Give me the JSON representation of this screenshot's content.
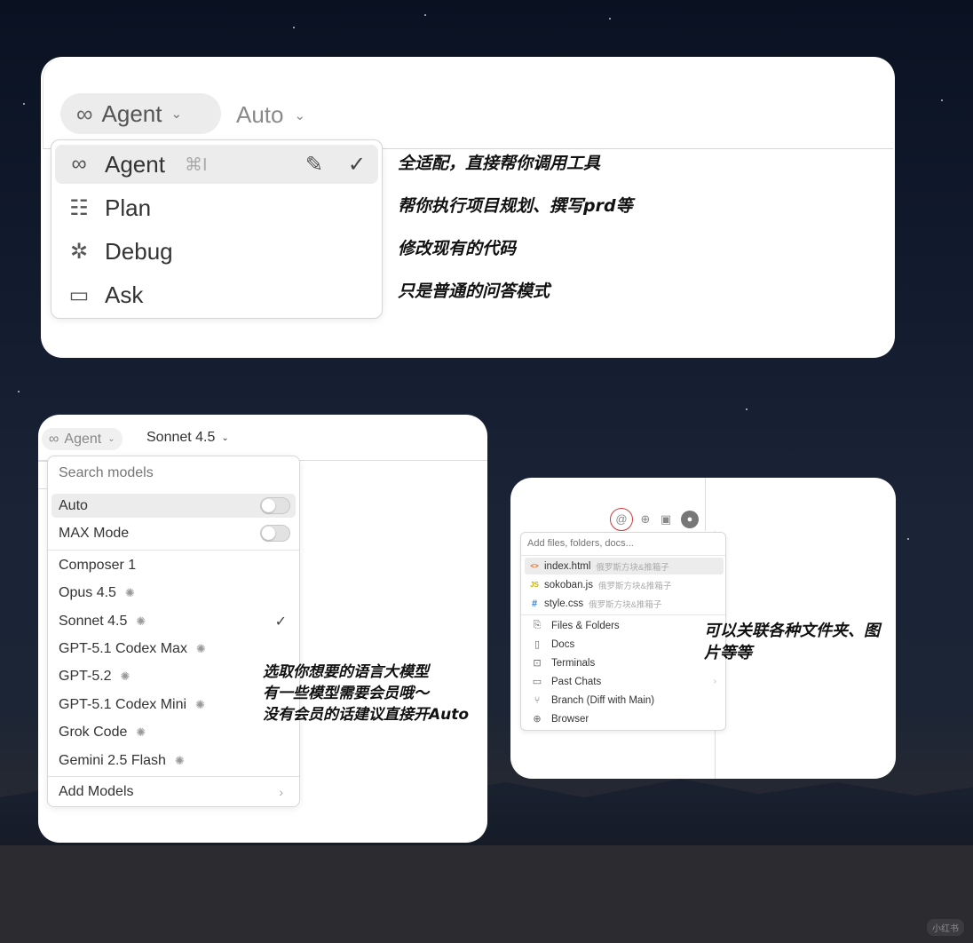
{
  "card1": {
    "mode_pill": {
      "icon": "infinity-icon",
      "label": "Agent"
    },
    "model_selector": {
      "label": "Auto"
    },
    "mode_menu": [
      {
        "icon": "infinity-icon",
        "label": "Agent",
        "shortcut": "⌘I",
        "selected": true
      },
      {
        "icon": "plan-list-icon",
        "label": "Plan"
      },
      {
        "icon": "bug-icon",
        "label": "Debug"
      },
      {
        "icon": "chat-bubble-icon",
        "label": "Ask"
      }
    ],
    "annotations": [
      "全适配，直接帮你调用工具",
      "帮你执行项目规划、撰写prd等",
      "修改现有的代码",
      "只是普通的问答模式"
    ]
  },
  "card2": {
    "mode_pill": {
      "label": "Agent"
    },
    "model_selector": {
      "label": "Sonnet 4.5"
    },
    "search_placeholder": "Search models",
    "toggles": [
      {
        "label": "Auto",
        "on": false
      },
      {
        "label": "MAX Mode",
        "on": false
      }
    ],
    "models": [
      {
        "label": "Composer 1",
        "thinking": false,
        "selected": false
      },
      {
        "label": "Opus 4.5",
        "thinking": true,
        "selected": false
      },
      {
        "label": "Sonnet 4.5",
        "thinking": true,
        "selected": true
      },
      {
        "label": "GPT-5.1 Codex Max",
        "thinking": true,
        "selected": false
      },
      {
        "label": "GPT-5.2",
        "thinking": true,
        "selected": false
      },
      {
        "label": "GPT-5.1 Codex Mini",
        "thinking": true,
        "selected": false
      },
      {
        "label": "Grok Code",
        "thinking": true,
        "selected": false
      },
      {
        "label": "Gemini 2.5 Flash",
        "thinking": true,
        "selected": false
      }
    ],
    "add_models_label": "Add Models",
    "annotation": [
      "选取你想要的语言大模型",
      "有一些模型需要会员哦～",
      "没有会员的话建议直接开Auto"
    ]
  },
  "card3": {
    "toolbar_icons": [
      "at-icon",
      "globe-icon",
      "image-icon",
      "microphone-icon"
    ],
    "input_placeholder": "Add files, folders, docs...",
    "files": [
      {
        "icon": "<>",
        "icon_color": "#e06c2b",
        "name": "index.html",
        "path": "俄罗斯方块&推箱子"
      },
      {
        "icon": "JS",
        "icon_color": "#c9b400",
        "name": "sokoban.js",
        "path": "俄罗斯方块&推箱子"
      },
      {
        "icon": "#",
        "icon_color": "#3a7bd5",
        "name": "style.css",
        "path": "俄罗斯方块&推箱子"
      }
    ],
    "sources": [
      {
        "icon": "files-icon",
        "glyph": "⎘",
        "label": "Files & Folders"
      },
      {
        "icon": "book-icon",
        "glyph": "▯",
        "label": "Docs"
      },
      {
        "icon": "terminal-icon",
        "glyph": "⊡",
        "label": "Terminals"
      },
      {
        "icon": "chat-bubble-icon",
        "glyph": "▭",
        "label": "Past Chats",
        "submenu": true
      },
      {
        "icon": "branch-icon",
        "glyph": "⑂",
        "label": "Branch (Diff with Main)"
      },
      {
        "icon": "globe-icon",
        "glyph": "⊕",
        "label": "Browser"
      }
    ],
    "annotation": [
      "可以关联各种文件夹、图",
      "片等等"
    ]
  },
  "watermark": "小红书",
  "colors": {
    "selected_bg": "#ececec",
    "at_ring": "#d23a3a"
  }
}
